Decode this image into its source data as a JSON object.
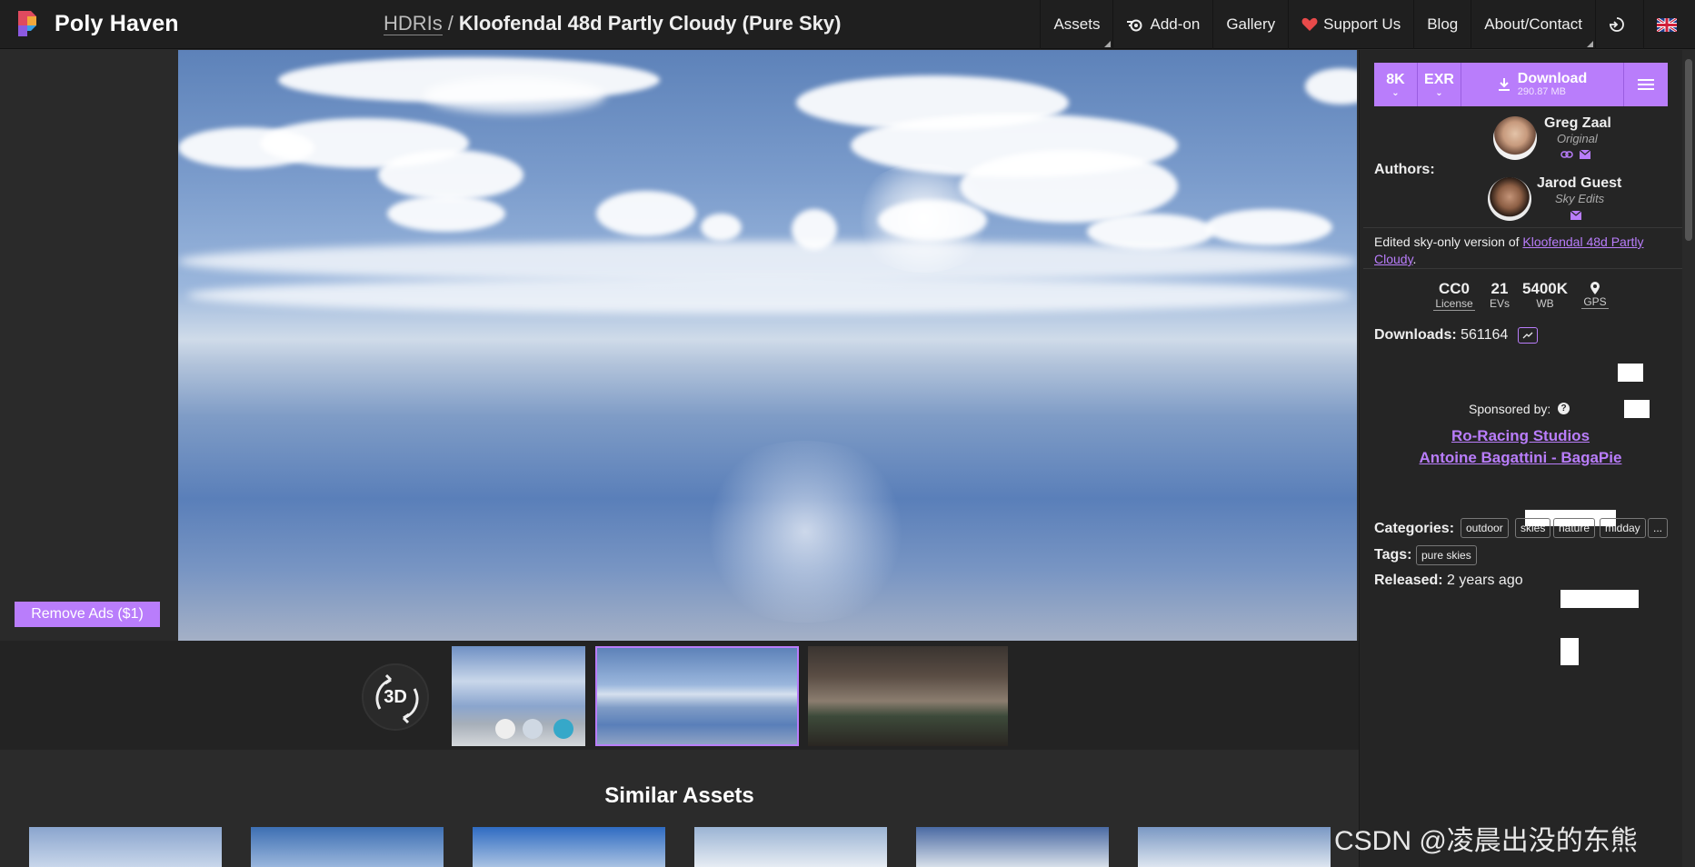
{
  "header": {
    "site_name": "Poly Haven",
    "breadcrumb_category": "HDRIs",
    "breadcrumb_separator": "/",
    "asset_title": "Kloofendal 48d Partly Cloudy (Pure Sky)",
    "nav": [
      "Assets",
      "Add-on",
      "Gallery",
      "Support Us",
      "Blog",
      "About/Contact"
    ],
    "icons": [
      "blender-icon",
      "heart-icon",
      "login-icon",
      "uk-flag-icon"
    ]
  },
  "left": {
    "remove_ads": "Remove Ads ($1)"
  },
  "viewer": {
    "btn_3d": "3D"
  },
  "download": {
    "resolution": "8K",
    "format": "EXR",
    "label": "Download",
    "size": "290.87 MB",
    "accent": "#b97dfb"
  },
  "authors": {
    "label": "Authors:",
    "list": [
      {
        "name": "Greg Zaal",
        "role": "Original"
      },
      {
        "name": "Jarod Guest",
        "role": "Sky Edits"
      }
    ]
  },
  "description": {
    "prefix": "Edited sky-only version of ",
    "link": "Kloofendal 48d Partly Cloudy",
    "suffix": "."
  },
  "stats": [
    {
      "value": "CC0",
      "label": "License"
    },
    {
      "value": "21",
      "label": "EVs"
    },
    {
      "value": "5400K",
      "label": "WB"
    },
    {
      "value": "",
      "label": "GPS"
    }
  ],
  "downloads": {
    "label": "Downloads:",
    "count": "561164"
  },
  "sponsors": {
    "label": "Sponsored by:",
    "list": [
      "Ro-Racing Studios",
      "Antoine Bagattini - BagaPie"
    ]
  },
  "categories": {
    "label": "Categories:",
    "items": [
      "outdoor",
      "skies",
      "nature",
      "midday",
      "..."
    ]
  },
  "tags": {
    "label": "Tags:",
    "items": [
      "pure skies"
    ]
  },
  "released": {
    "label": "Released:",
    "value": "2 years ago"
  },
  "similar": {
    "title": "Similar Assets"
  },
  "watermark": "CSDN @凌晨出没的东熊"
}
